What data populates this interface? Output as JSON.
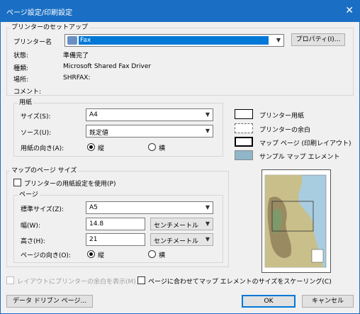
{
  "window": {
    "title": "ページ設定/印刷設定",
    "close_glyph": "✕"
  },
  "printer_setup": {
    "legend": "プリンターのセットアップ",
    "name_label": "プリンター名",
    "name_value": "Fax",
    "properties_button": "プロパティ(I)...",
    "status_label": "状態:",
    "status_value": "準備完了",
    "type_label": "種類:",
    "type_value": "Microsoft Shared Fax Driver",
    "location_label": "場所:",
    "location_value": "SHRFAX:",
    "comment_label": "コメント:"
  },
  "paper": {
    "legend": "用紙",
    "size_label": "サイズ(S):",
    "size_value": "A4",
    "source_label": "ソース(U):",
    "source_value": "既定値",
    "orientation_label": "用紙の向き(A):",
    "portrait": "縦",
    "landscape": "横",
    "selected": "portrait"
  },
  "map_page_size": {
    "legend": "マップのページ サイズ",
    "use_printer_settings": "プリンターの用紙設定を使用(P)",
    "page_legend": "ページ",
    "standard_size_label": "標準サイズ(Z):",
    "standard_size_value": "A5",
    "width_label": "幅(W):",
    "width_value": "14.8",
    "width_unit": "センチメートル",
    "height_label": "高さ(H):",
    "height_value": "21",
    "height_unit": "センチメートル",
    "orientation_label": "ページの向き(O):",
    "portrait": "縦",
    "landscape": "横",
    "selected": "portrait"
  },
  "legend_panel": {
    "printer_paper": "プリンター用紙",
    "printer_margin": "プリンターの余白",
    "map_page": "マップ ページ (印刷レイアウト)",
    "sample_elements": "サンプル マップ エレメント"
  },
  "options": {
    "show_margins": "レイアウトにプリンターの余白を表示(M)",
    "scale_elements": "ページに合わせてマップ エレメントのサイズをスケーリング(C)"
  },
  "buttons": {
    "data_driven": "データ ドリブン ページ...",
    "ok": "OK",
    "cancel": "キャンセル"
  },
  "colors": {
    "title_bar": "#1a6fc4",
    "selection": "#0078d7"
  },
  "icons": {
    "printer": "fax-printer-icon",
    "dropdown": "chevron-down-icon"
  }
}
